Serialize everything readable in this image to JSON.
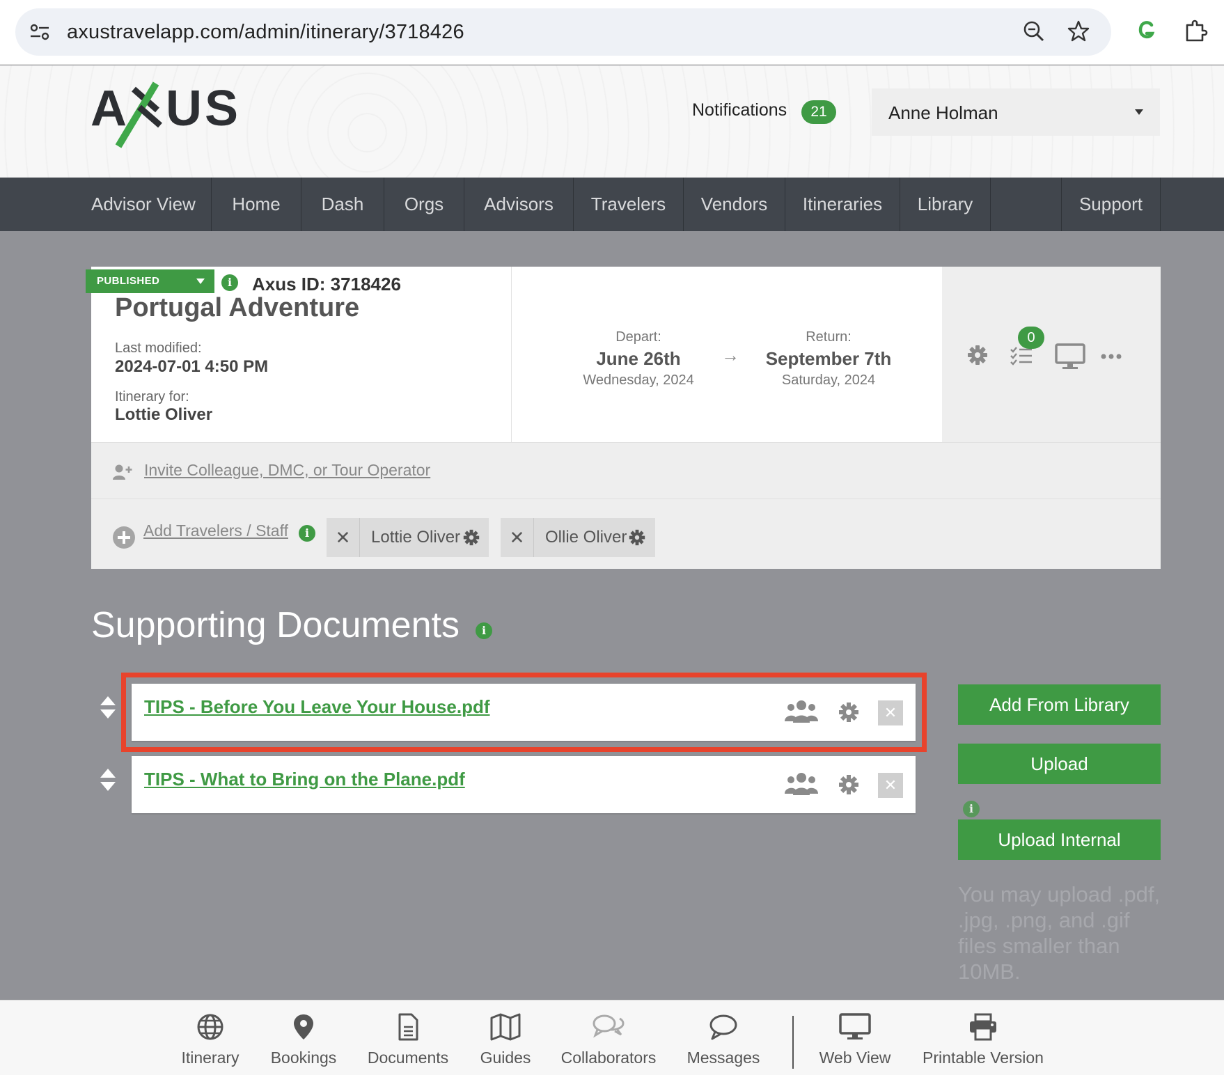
{
  "browser": {
    "url": "axustravelapp.com/admin/itinerary/3718426"
  },
  "header": {
    "logo_text": "AXUS",
    "notifications_label": "Notifications",
    "notifications_count": "21",
    "user_name": "Anne Holman"
  },
  "nav": {
    "items": [
      "Advisor View",
      "Home",
      "Dash",
      "Orgs",
      "Advisors",
      "Travelers",
      "Vendors",
      "Itineraries",
      "Library",
      "Support"
    ]
  },
  "itinerary": {
    "status": "PUBLISHED",
    "axus_id": "Axus ID: 3718426",
    "title": "Portugal Adventure",
    "last_modified_label": "Last modified:",
    "last_modified_value": "2024-07-01 4:50 PM",
    "for_label": "Itinerary for:",
    "for_value": "Lottie Oliver",
    "depart_label": "Depart:",
    "depart_date": "June 26th",
    "depart_day": "Wednesday, 2024",
    "return_label": "Return:",
    "return_date": "September 7th",
    "return_day": "Saturday, 2024",
    "arrow": "→",
    "checklist_count": "0",
    "invite_label": "Invite Colleague, DMC, or Tour Operator",
    "add_travelers_label": "Add Travelers / Staff",
    "travelers": [
      "Lottie Oliver",
      "Ollie Oliver"
    ]
  },
  "documents": {
    "title": "Supporting Documents",
    "items": [
      "TIPS - Before You Leave Your House.pdf",
      "TIPS - What to Bring on the Plane.pdf"
    ],
    "add_from_library": "Add From Library",
    "upload": "Upload",
    "upload_internal": "Upload Internal",
    "upload_note": "You may upload .pdf, .jpg, .png, and .gif files smaller than 10MB."
  },
  "bottom_bar": {
    "items": [
      "Itinerary",
      "Bookings",
      "Documents",
      "Guides",
      "Collaborators",
      "Messages",
      "Web View",
      "Printable Version"
    ]
  },
  "colors": {
    "accent_green": "#3f9a44",
    "nav_bg": "#41464d",
    "page_bg": "#919297",
    "highlight_red": "#e8432c"
  }
}
